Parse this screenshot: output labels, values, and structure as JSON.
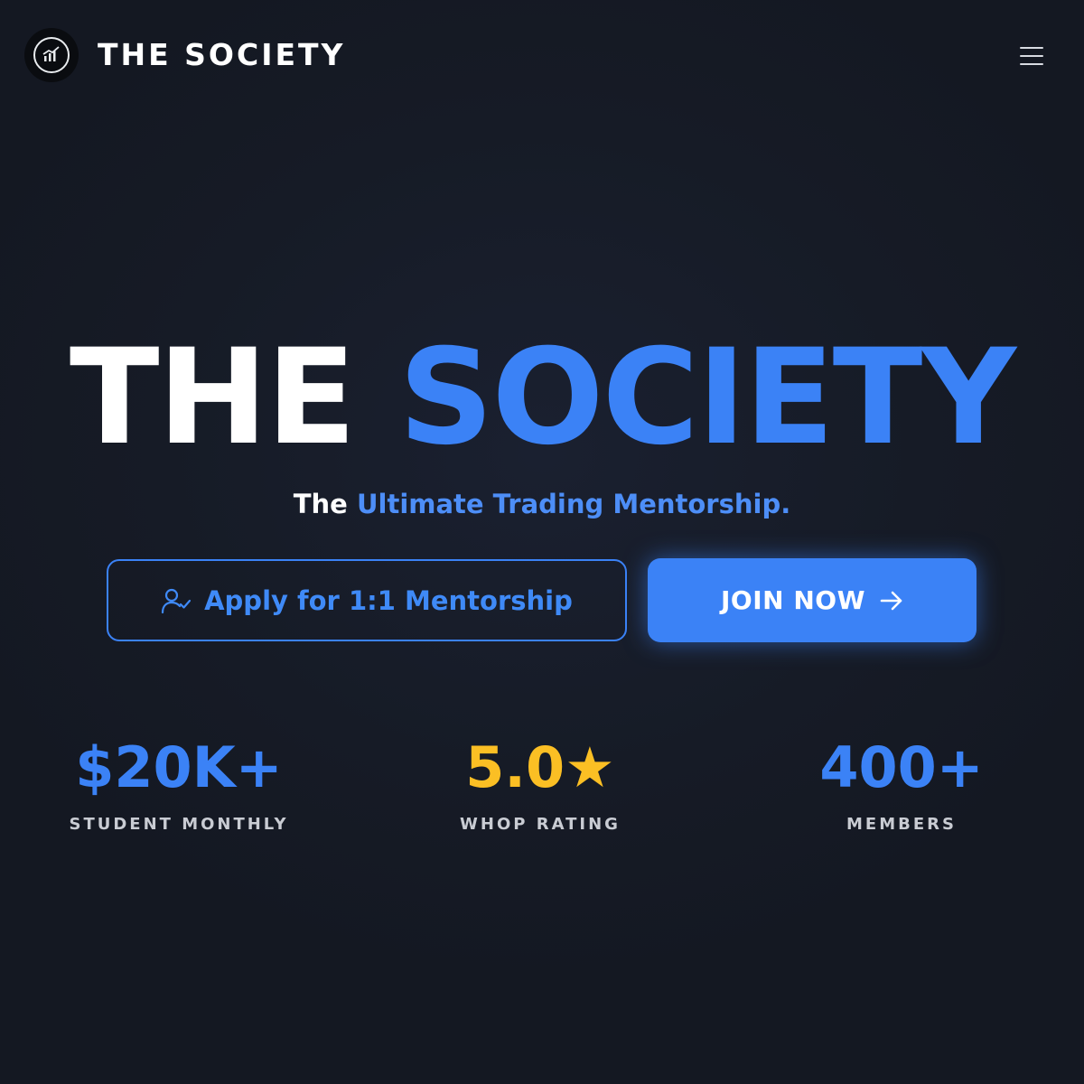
{
  "header": {
    "brand": "THE SOCIETY",
    "logo_icon": "chart-trend-icon",
    "menu_icon": "hamburger-menu-icon"
  },
  "hero": {
    "title_part1": "THE",
    "title_part2": "SOCIETY",
    "tagline_part1": "The",
    "tagline_part2": "Ultimate Trading Mentorship."
  },
  "actions": {
    "apply_label": "Apply for 1:1 Mentorship",
    "apply_icon": "user-check-icon",
    "join_label": "JOIN NOW",
    "join_icon": "arrow-right-icon"
  },
  "stats": [
    {
      "value": "$20K+",
      "label": "STUDENT MONTHLY",
      "color": "#3b82f6"
    },
    {
      "value": "5.0",
      "star": "★",
      "label": "WHOP RATING",
      "color": "#fbbf24"
    },
    {
      "value": "400+",
      "label": "MEMBERS",
      "color": "#3b82f6"
    }
  ],
  "colors": {
    "background": "#161b26",
    "accent": "#3b82f6",
    "rating": "#fbbf24",
    "text": "#ffffff"
  }
}
